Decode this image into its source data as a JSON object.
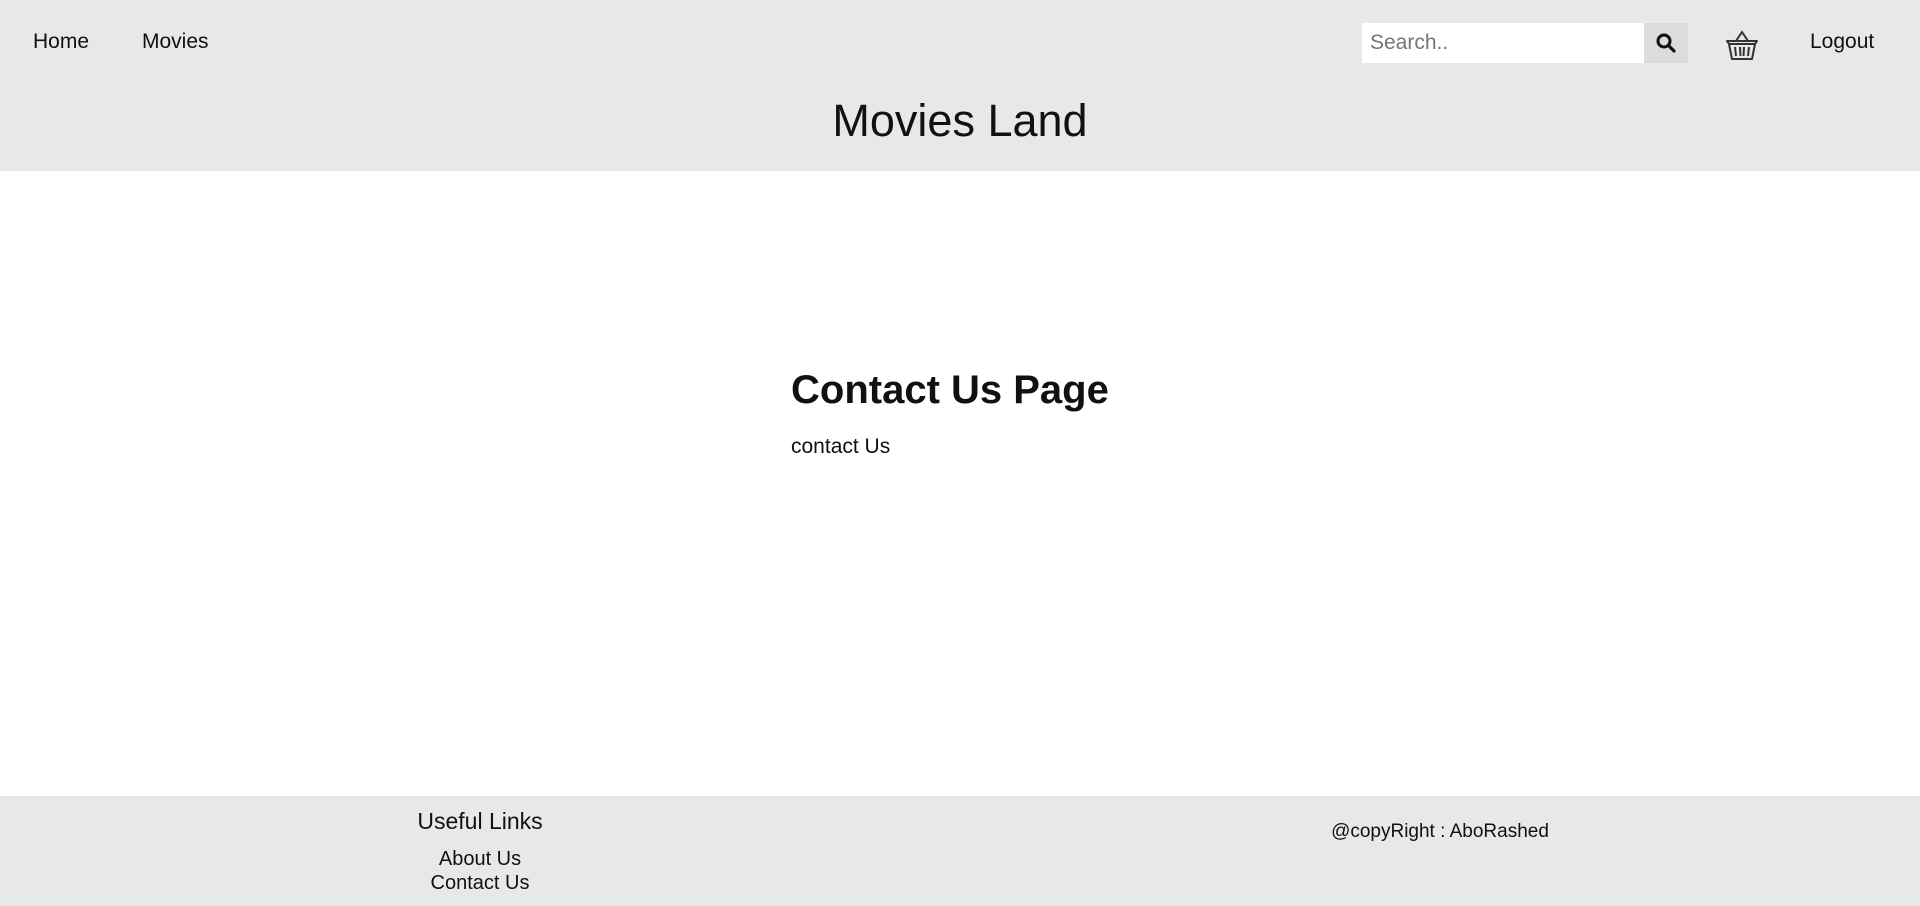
{
  "header": {
    "nav": [
      {
        "label": "Home"
      },
      {
        "label": "Movies"
      }
    ],
    "search": {
      "placeholder": "Search..",
      "value": ""
    },
    "logout_label": "Logout",
    "site_title": "Movies Land",
    "icons": {
      "search": "search-icon",
      "cart": "basket-icon"
    }
  },
  "main": {
    "title": "Contact Us Page",
    "text": "contact Us"
  },
  "footer": {
    "heading": "Useful Links",
    "links": [
      {
        "label": "About Us"
      },
      {
        "label": "Contact Us"
      }
    ],
    "copyright": "@copyRight : AboRashed"
  },
  "colors": {
    "header_bg": "#e8e8e8",
    "footer_bg": "#e8e8e8",
    "search_button_bg": "#dcdcdc",
    "text": "#111111"
  }
}
